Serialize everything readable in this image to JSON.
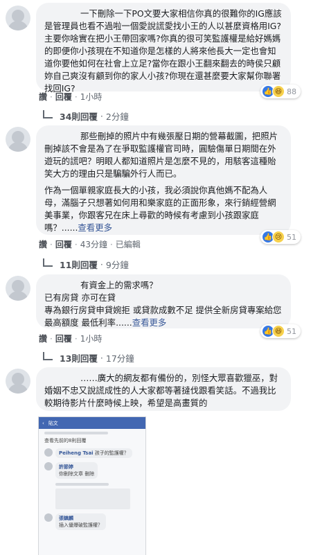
{
  "comments": [
    {
      "paragraphs": [
        "一下刪除一下PO文要大家相信你真的很難你的IG應該是管理員也看不過啦一個愛說謊愛找小王的人以甚麼資格用IG?主要你啥實在把小王帶回家嗎?你真的很可笑監護權是給好媽媽的即便你小孩現在不知道你是怎樣的人將來他長大一定也會知道你要他如何在社會上立足?當你在跟小王翻來翻去的時侯只顧妳自己爽沒有顧到你的家人小孩?你現在還甚麼要大家幫你聯署找回IG?"
      ],
      "actions": {
        "like": "讚",
        "reply": "回覆",
        "time": "1小時",
        "edited": ""
      },
      "reactions": {
        "count": "88",
        "icons": [
          "like-icon",
          "haha-icon"
        ]
      },
      "replies_label": "34則回覆",
      "replies_time": "2分鐘"
    },
    {
      "paragraphs": [
        "那些刪掉的照片中有幾張壓日期的營幕截圖，把照片刪掉該不會是為了在爭取監護權官司時，圓驗傷單日期間在外遊玩的謊吧？明眼人都知道照片是怎麼不見的，用駭客這種貽笑大方的理由只是騙騙外行人而已。",
        "作為一個單親家庭長大的小孩，我必須說你真他媽不配為人母，滿腦子只想著如何用和樂家庭的正面形象，來行銷經營網美事業，你跟客兄在床上尋歡的時候有考慮到小孩跟家庭嗎？......"
      ],
      "see_more": "查看更多",
      "actions": {
        "like": "讚",
        "reply": "回覆",
        "time": "43分鐘",
        "edited": "已編輯"
      },
      "reactions": {
        "count": "51",
        "icons": [
          "like-icon",
          "sad-icon"
        ]
      },
      "replies_label": "11則回覆",
      "replies_time": "9分鐘"
    },
    {
      "paragraphs": [
        "有資金上的需求嗎？",
        "已有房貸 亦可在貸",
        "專為銀行房貸申貸婉拒 或貸款成數不足 提供全新房貸專案給您最高額度 最低利率......"
      ],
      "see_more": "查看更多",
      "actions": {
        "like": "讚",
        "reply": "回覆",
        "time": "1小時",
        "edited": ""
      },
      "reactions": {
        "count": "51",
        "icons": [
          "like-icon",
          "haha-icon"
        ]
      },
      "replies_label": "13則回覆",
      "replies_time": "17分鐘"
    },
    {
      "paragraphs": [
        "……廣大的網友都有備份的，別怪大眾喜歡獵巫，對婚姻不忠又說謊成性的人大家都等著撻伐跟看笑話。不過我比較期待影片什麼時候上映，希望是高畫質的"
      ]
    }
  ],
  "photo": {
    "header_title": "貼文",
    "lines": [
      "查看先前的8則回覆"
    ],
    "comment_1_name": "Peiheng Tsai",
    "comment_1_text": "孩子的監護權？",
    "comment_2_name": "許節婷",
    "comment_2_text": "你刪除文章 刪除",
    "comment_3_name": "張鎮麟",
    "comment_3_text": "插入優爆破監護權？"
  },
  "colors": {
    "like": "#3578e5",
    "link": "#385898",
    "bubble": "#f2f3f5"
  }
}
